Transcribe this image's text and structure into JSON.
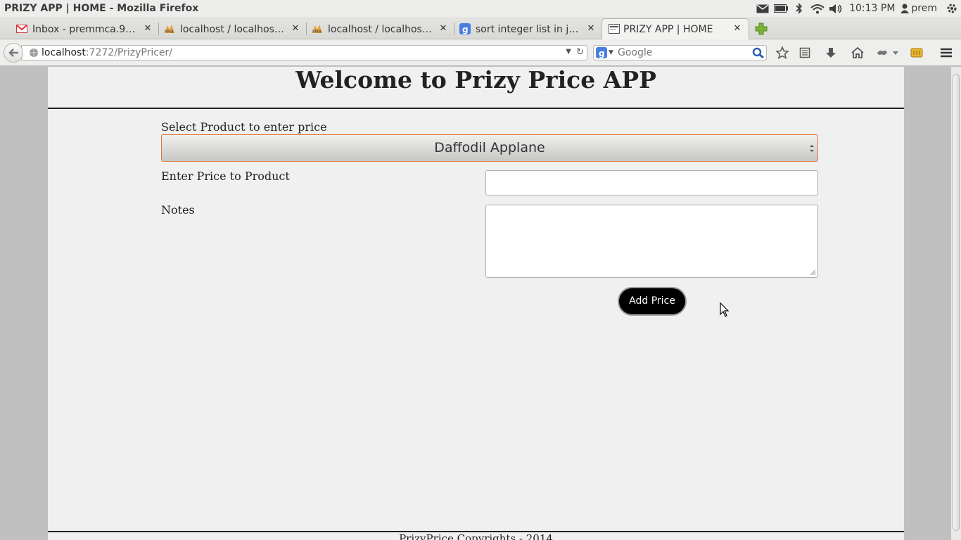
{
  "os": {
    "window_title": "PRIZY APP | HOME - Mozilla Firefox",
    "time": "10:13 PM",
    "user": "prem"
  },
  "tabs": [
    {
      "label": "Inbox - premmca.90...",
      "icon": "gmail-icon"
    },
    {
      "label": "localhost / localhost...",
      "icon": "phpmyadmin-icon"
    },
    {
      "label": "localhost / localhost...",
      "icon": "phpmyadmin-icon"
    },
    {
      "label": "sort integer list in ja...",
      "icon": "google-icon"
    },
    {
      "label": "PRIZY APP | HOME",
      "icon": "page-icon",
      "active": true
    }
  ],
  "nav": {
    "url_host": "localhost",
    "url_path": ":7272/PrizyPricer/",
    "search_placeholder": "Google"
  },
  "page": {
    "title": "Welcome to Prizy Price APP",
    "select_label": "Select Product to enter price",
    "selected_product": "Daffodil Applane",
    "price_label": "Enter Price to Product",
    "price_value": "",
    "notes_label": "Notes",
    "notes_value": "",
    "add_button": "Add Price",
    "footer": "PrizyPrice Copyrights - 2014"
  },
  "colors": {
    "select_focus_border": "#e0773b",
    "button_bg": "#000000",
    "page_bg": "#f0f0f0",
    "outer_bg": "#c0c0c0"
  }
}
